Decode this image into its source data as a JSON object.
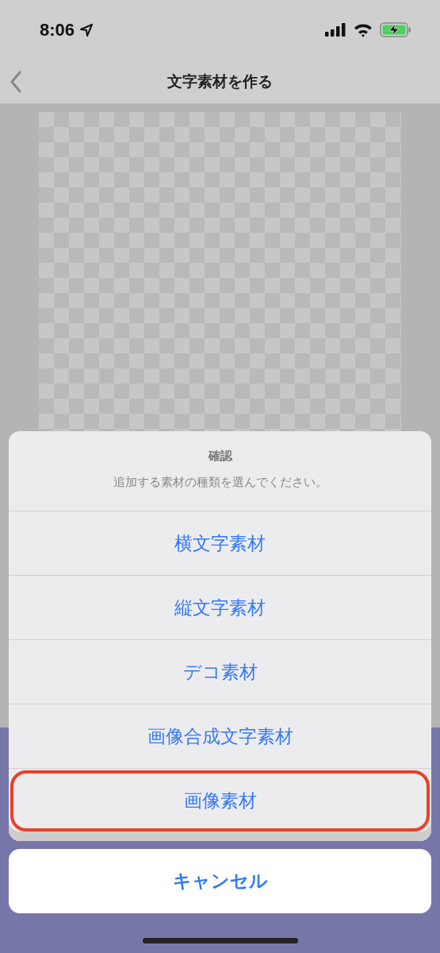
{
  "status_bar": {
    "time": "8:06"
  },
  "nav_bar": {
    "title": "文字素材を作る"
  },
  "action_sheet": {
    "title": "確認",
    "message": "追加する素材の種類を選んでください。",
    "options": [
      {
        "label": "横文字素材",
        "highlighted": false
      },
      {
        "label": "縦文字素材",
        "highlighted": false
      },
      {
        "label": "デコ素材",
        "highlighted": false
      },
      {
        "label": "画像合成文字素材",
        "highlighted": false
      },
      {
        "label": "画像素材",
        "highlighted": true
      }
    ],
    "cancel": "キャンセル"
  }
}
